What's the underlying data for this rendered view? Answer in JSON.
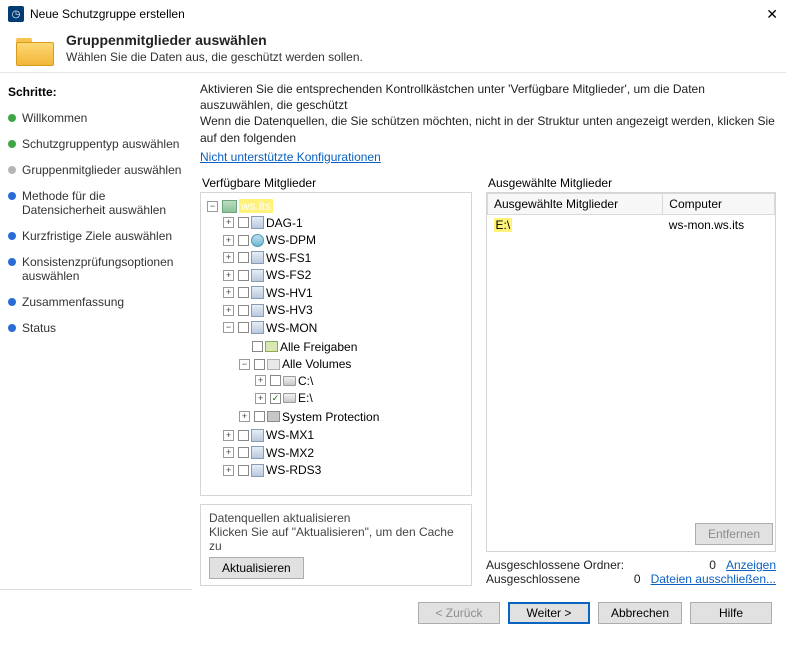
{
  "window": {
    "title": "Neue Schutzgruppe erstellen",
    "close": "✕"
  },
  "header": {
    "title": "Gruppenmitglieder auswählen",
    "subtitle": "Wählen Sie die Daten aus, die geschützt werden sollen."
  },
  "steps": {
    "heading": "Schritte:",
    "items": [
      {
        "label": "Willkommen",
        "state": "done"
      },
      {
        "label": "Schutzgruppentyp auswählen",
        "state": "done"
      },
      {
        "label": "Gruppenmitglieder auswählen",
        "state": "current"
      },
      {
        "label": "Methode für die Datensicherheit auswählen",
        "state": "future"
      },
      {
        "label": "Kurzfristige Ziele auswählen",
        "state": "future"
      },
      {
        "label": "Konsistenzprüfungsoptionen auswählen",
        "state": "future"
      },
      {
        "label": "Zusammenfassung",
        "state": "future"
      },
      {
        "label": "Status",
        "state": "future"
      }
    ]
  },
  "content": {
    "desc1": "Aktivieren Sie die entsprechenden Kontrollkästchen unter 'Verfügbare Mitglieder', um die Daten auszuwählen, die geschützt",
    "desc2": "Wenn die Datenquellen, die Sie schützen möchten, nicht in der Struktur unten angezeigt werden, klicken Sie auf den folgenden",
    "unsupported_link": "Nicht unterstützte Konfigurationen",
    "available_label": "Verfügbare Mitglieder",
    "selected_label": "Ausgewählte Mitglieder"
  },
  "tree": {
    "root": "ws.its",
    "nodes": [
      {
        "label": "DAG-1",
        "icon": "server",
        "exp": "+"
      },
      {
        "label": "WS-DPM",
        "icon": "srvdpm",
        "exp": "+"
      },
      {
        "label": "WS-FS1",
        "icon": "server",
        "exp": "+"
      },
      {
        "label": "WS-FS2",
        "icon": "server",
        "exp": "+"
      },
      {
        "label": "WS-HV1",
        "icon": "server",
        "exp": "+"
      },
      {
        "label": "WS-HV3",
        "icon": "server",
        "exp": "+"
      }
    ],
    "mon": {
      "label": "WS-MON",
      "share": "Alle Freigaben",
      "volumes": "Alle Volumes",
      "c": "C:\\",
      "e": "E:\\",
      "sys": "System Protection"
    },
    "tail": [
      {
        "label": "WS-MX1",
        "icon": "server",
        "exp": "+"
      },
      {
        "label": "WS-MX2",
        "icon": "server",
        "exp": "+"
      },
      {
        "label": "WS-RDS3",
        "icon": "server",
        "exp": "+"
      }
    ]
  },
  "selected": {
    "col1": "Ausgewählte Mitglieder",
    "col2": "Computer",
    "rows": [
      {
        "m": "E:\\",
        "c": "ws-mon.ws.its"
      }
    ],
    "remove": "Entfernen",
    "excl_folders_label": "Ausgeschlossene Ordner:",
    "excl_folders_count": "0",
    "show_link": "Anzeigen",
    "excl_label": "Ausgeschlossene",
    "excl_count": "0",
    "excl_link": "Dateien ausschließen..."
  },
  "datasrc": {
    "title": "Datenquellen aktualisieren",
    "hint": "Klicken Sie auf \"Aktualisieren\", um den Cache zu",
    "btn": "Aktualisieren"
  },
  "footer": {
    "back": "< Zurück",
    "next": "Weiter >",
    "cancel": "Abbrechen",
    "help": "Hilfe"
  }
}
